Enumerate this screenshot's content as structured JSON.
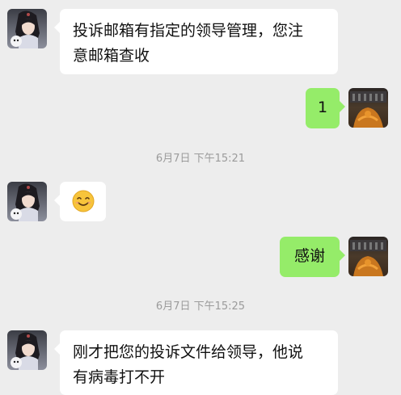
{
  "colors": {
    "background": "#ededed",
    "incoming_bubble": "#ffffff",
    "outgoing_bubble": "#95ec69",
    "timestamp_text": "#9b9b9b"
  },
  "messages": [
    {
      "direction": "incoming",
      "lines": [
        "投诉邮箱有指定的领导管理，您注",
        "意邮箱查收"
      ]
    },
    {
      "direction": "outgoing",
      "text": "1"
    },
    {
      "type": "timestamp",
      "text": "6月7日 下午15:21"
    },
    {
      "direction": "incoming",
      "emoji": "smiling-face-emoji"
    },
    {
      "direction": "outgoing",
      "text": "感谢"
    },
    {
      "type": "timestamp",
      "text": "6月7日 下午15:25"
    },
    {
      "direction": "incoming",
      "lines": [
        "刚才把您的投诉文件给领导，他说",
        "有病毒打不开"
      ]
    }
  ]
}
